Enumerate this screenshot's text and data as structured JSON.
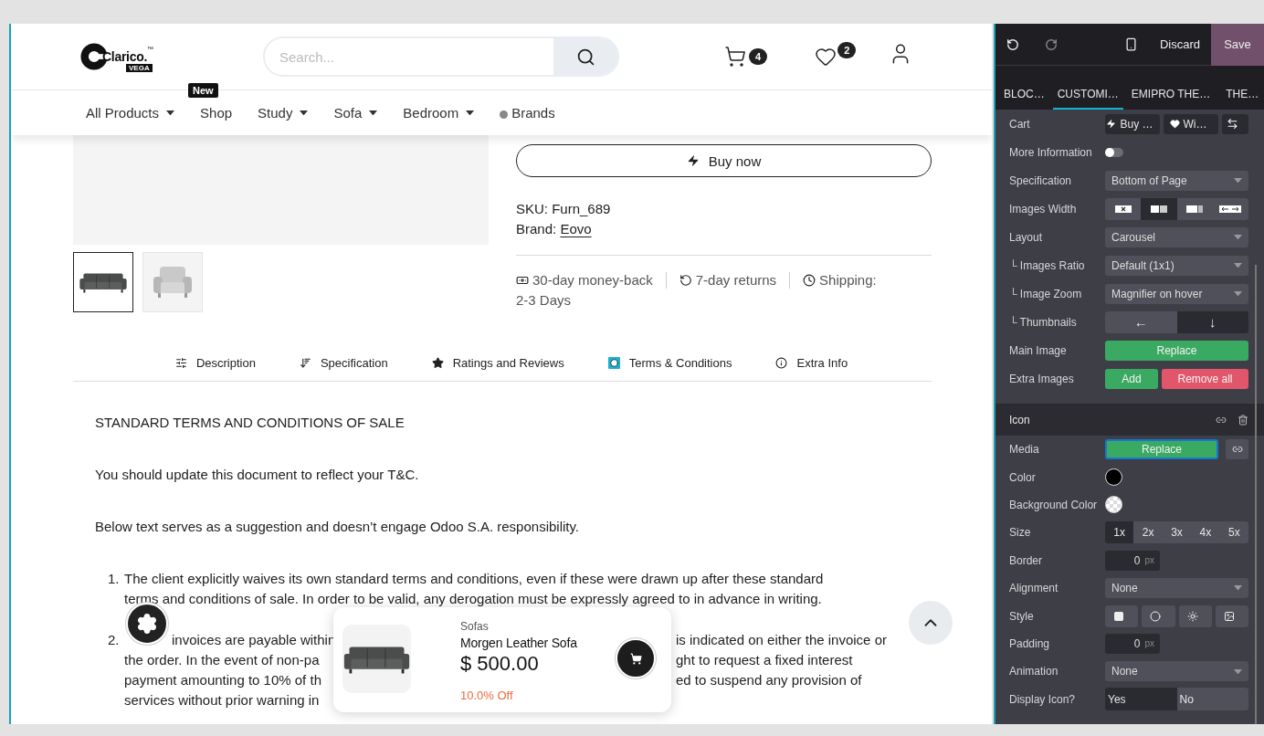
{
  "header": {
    "logo": {
      "name": "Clarico.",
      "trademark": "™",
      "edition": "VEGA"
    },
    "search": {
      "placeholder": "Search..."
    },
    "cart_count": "4",
    "wishlist_count": "2"
  },
  "nav": [
    {
      "label": "All Products",
      "dropdown": true,
      "dot": false
    },
    {
      "label": "Shop",
      "dropdown": false,
      "dot": false,
      "badge": "New"
    },
    {
      "label": "Study",
      "dropdown": true,
      "dot": false
    },
    {
      "label": "Sofa",
      "dropdown": true,
      "dot": false
    },
    {
      "label": "Bedroom",
      "dropdown": true,
      "dot": false
    },
    {
      "label": "Brands",
      "dropdown": false,
      "dot": true
    }
  ],
  "product": {
    "thumbnails": [
      {
        "kind": "sofa",
        "selected": true
      },
      {
        "kind": "armchair",
        "selected": false
      }
    ],
    "buy_now": "Buy now",
    "sku_label": "SKU:",
    "sku": "Furn_689",
    "brand_label": "Brand:",
    "brand": "Eovo",
    "features": [
      {
        "text": "30-day money-back"
      },
      {
        "text": "7-day returns"
      },
      {
        "text": "Shipping:"
      }
    ],
    "shipping_time": "2-3 Days"
  },
  "tabs": [
    {
      "label": "Description",
      "selected": false
    },
    {
      "label": "Specification",
      "selected": false
    },
    {
      "label": "Ratings and Reviews",
      "selected": false
    },
    {
      "label": "Terms & Conditions",
      "selected": true
    },
    {
      "label": "Extra Info",
      "selected": false
    }
  ],
  "content": {
    "heading": "STANDARD TERMS AND CONDITIONS OF SALE",
    "paragraphs": [
      "You should update this document to reflect your T&C.",
      "Below text serves as a suggestion and doesn’t engage Odoo S.A. responsibility."
    ],
    "list": [
      {
        "number": "1.",
        "text": "The client explicitly waives its own standard terms and conditions, even if these were drawn up after these standard terms and conditions of sale. In order to be valid, any derogation must be expressly agreed to in advance in writing."
      },
      {
        "number": "2.",
        "lines": [
          {
            "left": [
              "invoices are payable within"
            ],
            "right": "is indicated on either the invoice or"
          },
          {
            "left": [
              "the order. In the event of non-pa"
            ],
            "right": "ght to request a fixed interest"
          },
          {
            "left": [
              "payment amounting to 10% of th"
            ],
            "right": "ed to suspend any provision of"
          },
          {
            "left": [
              "services without prior warning in"
            ]
          }
        ]
      }
    ]
  },
  "popup": {
    "category": "Sofas",
    "name": "Morgen Leather Sofa",
    "price": "$ 500.00",
    "discount": "10.0% Off"
  },
  "panel": {
    "discard": "Discard",
    "save": "Save",
    "tabs": [
      {
        "label": "BLOC…",
        "selected": false
      },
      {
        "label": "CUSTOMI…",
        "selected": true
      },
      {
        "label": "EMIPRO THE…",
        "selected": false
      },
      {
        "label": "THE…",
        "selected": false
      }
    ],
    "options": [
      {
        "kind": "cart",
        "label": "Cart",
        "buttons": [
          "Buy …",
          "Wi…"
        ]
      },
      {
        "kind": "toggle",
        "label": "More Information",
        "on": false
      },
      {
        "kind": "select",
        "label": "Specification",
        "value": "Bottom of Page"
      },
      {
        "kind": "width",
        "label": "Images Width",
        "segments": [
          {
            "selected": false
          },
          {
            "selected": true
          },
          {
            "selected": false
          },
          {
            "selected": false
          }
        ]
      },
      {
        "kind": "select",
        "label": "Layout",
        "value": "Carousel"
      },
      {
        "kind": "select",
        "label": "└ Images Ratio",
        "value": "Default (1x1)"
      },
      {
        "kind": "select",
        "label": "└ Image Zoom",
        "value": "Magnifier on hover"
      },
      {
        "kind": "segments",
        "label": "└ Thumbnails",
        "segments": [
          {
            "text": "←",
            "selected": false
          },
          {
            "text": "↓",
            "selected": true
          }
        ]
      },
      {
        "kind": "actions",
        "label": "Main Image",
        "actions": [
          {
            "text": "Replace",
            "danger": false,
            "focused": false
          }
        ]
      },
      {
        "kind": "actions",
        "label": "Extra Images",
        "actions": [
          {
            "text": "Add",
            "danger": false,
            "focused": false
          },
          {
            "text": "Remove all",
            "danger": true,
            "focused": false
          }
        ]
      }
    ],
    "section": {
      "title": "Icon",
      "options": [
        {
          "kind": "media",
          "label": "Media",
          "actions": [
            {
              "text": "Replace",
              "danger": false,
              "focused": true
            }
          ]
        },
        {
          "kind": "color",
          "label": "Color",
          "color": "#000000"
        },
        {
          "kind": "color",
          "label": "Background Color",
          "transparent": true
        },
        {
          "kind": "segments",
          "label": "Size",
          "segments": [
            {
              "text": "1x",
              "selected": true
            },
            {
              "text": "2x",
              "selected": false
            },
            {
              "text": "3x",
              "selected": false
            },
            {
              "text": "4x",
              "selected": false
            },
            {
              "text": "5x",
              "selected": false
            }
          ]
        },
        {
          "kind": "number",
          "label": "Border",
          "value": "0",
          "unit": "px"
        },
        {
          "kind": "select",
          "label": "Alignment",
          "value": "None"
        },
        {
          "kind": "style",
          "label": "Style"
        },
        {
          "kind": "number",
          "label": "Padding",
          "value": "0",
          "unit": "px"
        },
        {
          "kind": "select",
          "label": "Animation",
          "value": "None"
        },
        {
          "kind": "choice",
          "label": "Display Icon?",
          "segments": [
            {
              "text": "Yes",
              "selected": true
            },
            {
              "text": "No",
              "selected": false
            }
          ]
        }
      ]
    }
  }
}
